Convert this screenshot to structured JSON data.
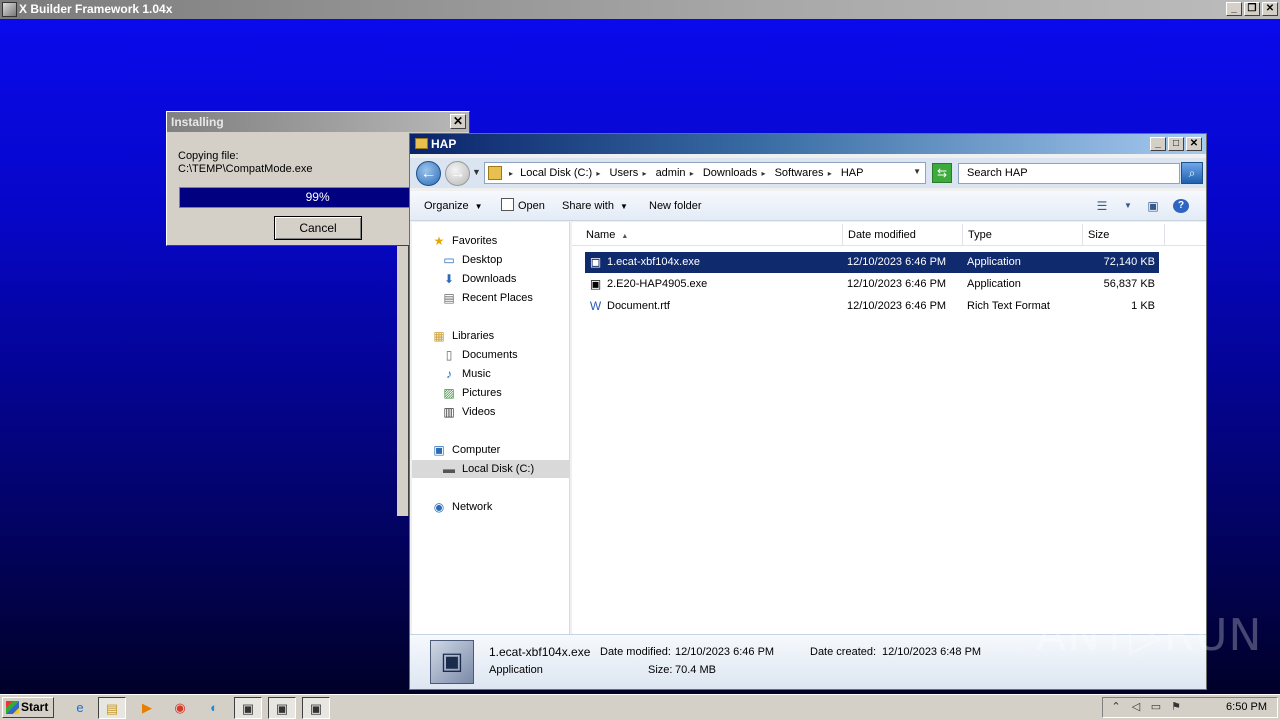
{
  "app_window": {
    "title": "X Builder Framework 1.04x",
    "controls": {
      "minimize": "_",
      "restore": "❐",
      "close": "✕"
    }
  },
  "install_dialog": {
    "title": "Installing",
    "close_label": "✕",
    "copy_label": "Copying file:",
    "copy_path": "C:\\TEMP\\CompatMode.exe",
    "progress_percent": 99,
    "progress_text": "99%",
    "cancel_label": "Cancel"
  },
  "explorer": {
    "title": "HAP",
    "controls": {
      "minimize": "_",
      "maximize": "□",
      "close": "✕"
    },
    "breadcrumbs": [
      "Local Disk (C:)",
      "Users",
      "admin",
      "Downloads",
      "Softwares",
      "HAP"
    ],
    "search_placeholder": "Search HAP",
    "toolbar": {
      "organize": "Organize",
      "open": "Open",
      "share_with": "Share with",
      "new_folder": "New folder"
    },
    "nav": {
      "favorites": "Favorites",
      "desktop": "Desktop",
      "downloads": "Downloads",
      "recent_places": "Recent Places",
      "libraries": "Libraries",
      "documents": "Documents",
      "music": "Music",
      "pictures": "Pictures",
      "videos": "Videos",
      "computer": "Computer",
      "local_disk": "Local Disk (C:)",
      "network": "Network"
    },
    "columns": {
      "name": "Name",
      "date_modified": "Date modified",
      "type": "Type",
      "size": "Size"
    },
    "files": [
      {
        "name": "1.ecat-xbf104x.exe",
        "date": "12/10/2023 6:46 PM",
        "type": "Application",
        "size": "72,140 KB",
        "icon": "application-icon",
        "selected": true
      },
      {
        "name": "2.E20-HAP4905.exe",
        "date": "12/10/2023 6:46 PM",
        "type": "Application",
        "size": "56,837 KB",
        "icon": "application-icon",
        "selected": false
      },
      {
        "name": "Document.rtf",
        "date": "12/10/2023 6:46 PM",
        "type": "Rich Text Format",
        "size": "1 KB",
        "icon": "wordpad-document-icon",
        "selected": false
      }
    ],
    "details": {
      "filename": "1.ecat-xbf104x.exe",
      "type": "Application",
      "date_modified_label": "Date modified:",
      "date_modified": "12/10/2023 6:46 PM",
      "date_created_label": "Date created:",
      "date_created": "12/10/2023 6:48 PM",
      "size_label": "Size:",
      "size": "70.4 MB"
    }
  },
  "taskbar": {
    "start_label": "Start",
    "clock": "6:50 PM"
  },
  "watermark": "ANY▷RUN"
}
